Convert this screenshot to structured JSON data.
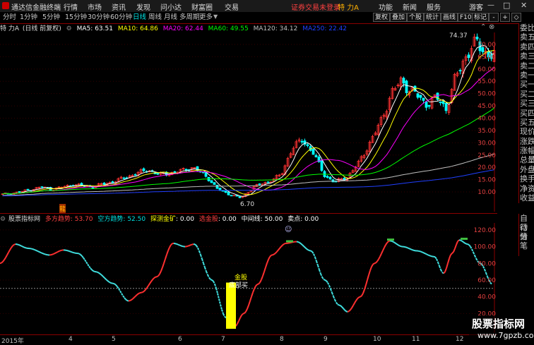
{
  "app": {
    "title": "通达信金融终端"
  },
  "menu": [
    "行情",
    "市场",
    "资讯",
    "发现",
    "问小达",
    "财富圈",
    "交易"
  ],
  "title_right": {
    "login_status": "证券交易未登录",
    "stock": "特 力A",
    "function": "功能",
    "news": "新闻",
    "service": "服务",
    "guest": "游客"
  },
  "toolbar": {
    "periods": [
      "分时",
      "1分钟",
      "5分钟",
      "15分钟",
      "30分钟",
      "60分钟",
      "日线",
      "周线",
      "月线",
      "多周期",
      "更多"
    ],
    "active_period": "日线",
    "right_buttons": [
      "复权",
      "叠加",
      "个股",
      "统计",
      "画线",
      "F10",
      "标记",
      "-",
      "+",
      "◇"
    ]
  },
  "main_legend": {
    "stock_label": "特 力A",
    "mode": "(日线 前复权)",
    "ma": [
      {
        "name": "MA5",
        "value": "63.51",
        "color": "#ffffff"
      },
      {
        "name": "MA10",
        "value": "64.86",
        "color": "#ffff00"
      },
      {
        "name": "MA20",
        "value": "62.44",
        "color": "#ff00ff"
      },
      {
        "name": "MA60",
        "value": "49.55",
        "color": "#00ff00"
      },
      {
        "name": "MA120",
        "value": "34.12",
        "color": "#c0c0c0"
      },
      {
        "name": "MA250",
        "value": "22.42",
        "color": "#2040ff"
      }
    ]
  },
  "price_axis": {
    "labels": [
      "70.00",
      "65.00",
      "60.00",
      "55.00",
      "50.00",
      "45.00",
      "40.00",
      "35.00",
      "30.00",
      "25.00",
      "20.00",
      "15.00",
      "10.00"
    ]
  },
  "annotations": {
    "high": "74.37",
    "low": "6.70",
    "marker": "龍"
  },
  "sub_legend": {
    "name": "股票指标网",
    "items": [
      {
        "label": "多方趋势",
        "value": "53.70",
        "label_color": "#ff4040",
        "value_color": "#ff4040"
      },
      {
        "label": "空方趋势",
        "value": "52.50",
        "label_color": "#00e0e0",
        "value_color": "#00e0e0"
      },
      {
        "label": "探测金矿",
        "value": "0.00",
        "label_color": "#ffff00",
        "value_color": "#ffffff"
      },
      {
        "label": "选金股",
        "value": "0.00",
        "label_color": "#ff4040",
        "value_color": "#ffffff"
      },
      {
        "label": "中间线",
        "value": "50.00",
        "label_color": "#ffffff",
        "value_color": "#ffffff"
      },
      {
        "label": "卖点",
        "value": "0.00",
        "label_color": "#ffffff",
        "value_color": "#ffffff"
      }
    ]
  },
  "sub_axis": {
    "labels": [
      "120.00",
      "100.00",
      "80.00",
      "60.00",
      "40.00",
      "20.00"
    ]
  },
  "sub_annotations": {
    "buy1": "金股",
    "buy2": "底部买"
  },
  "x_axis": {
    "labels": [
      "2015年",
      "4",
      "5",
      "6",
      "7",
      "8",
      "9",
      "10",
      "11",
      "12"
    ]
  },
  "right_panel": [
    "委比",
    "卖五",
    "卖四",
    "卖三",
    "卖二",
    "卖一",
    "买一",
    "买二",
    "买三",
    "买四",
    "买五",
    "现价",
    "涨跌",
    "涨幅",
    "总量",
    "外盘",
    "换手",
    "净资",
    "收益"
  ],
  "right_panel2": [
    "自动",
    "行情",
    "分笔"
  ],
  "watermark": {
    "line1": "股票指标网",
    "line2": "www.7gpzb.com"
  },
  "colors": {
    "up": "#ff3232",
    "down": "#00ffff",
    "bull_line": "#ff3030",
    "bear_line": "#40e0e0",
    "accent": "#8b0000"
  }
}
